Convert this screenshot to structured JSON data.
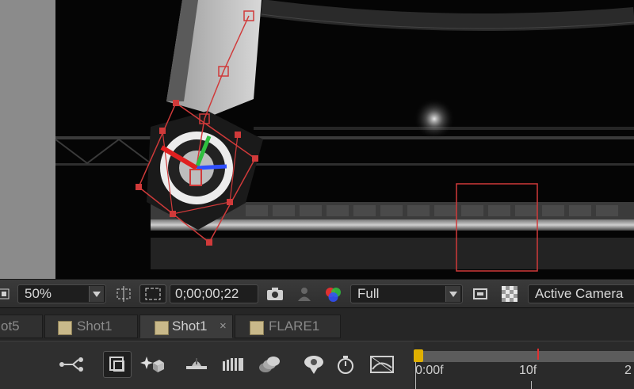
{
  "viewer_bar": {
    "magnification": "50%",
    "timecode": "0;00;00;22",
    "resolution": "Full",
    "camera_view": "Active Camera"
  },
  "tabs": [
    {
      "label": "ot5",
      "active": false
    },
    {
      "label": "Shot1",
      "active": false
    },
    {
      "label": "Shot1",
      "active": true
    },
    {
      "label": "FLARE1",
      "active": false
    }
  ],
  "timeline": {
    "ruler_labels": [
      "0:00f",
      "10f",
      "2"
    ]
  },
  "icons": {
    "snapshot": "camera-icon",
    "show_snapshot": "person-icon",
    "channels": "rgb-channels-icon",
    "fast_previews": "window-icon",
    "transparency_grid": "checkerboard-icon"
  },
  "colors": {
    "accent_red": "#d03a3a",
    "tab_swatch": "#c9b98a"
  }
}
